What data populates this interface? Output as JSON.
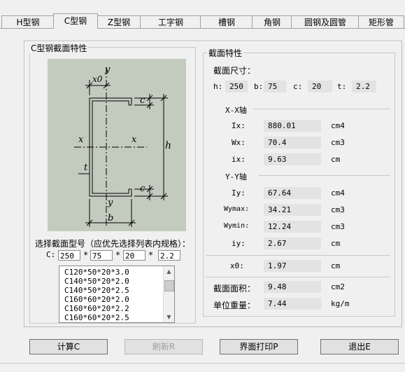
{
  "tabs": [
    "H型钢",
    "C型钢",
    "Z型钢",
    "工字钢",
    "槽钢",
    "角钢",
    "圆钢及圆管",
    "矩形管"
  ],
  "active_tab": 1,
  "left_group": {
    "title": "C型钢截面特性",
    "diagram": {
      "y_top": "y",
      "x0": "x0",
      "c_top": "c",
      "x_left": "x",
      "x_right": "x",
      "h": "h",
      "t": "t",
      "c_bottom": "c",
      "y_bottom": "y",
      "b": "b"
    },
    "select_label": "选择截面型号（应优先选择列表内规格）：",
    "c_label": "C:",
    "inputs": [
      "250",
      "75",
      "20",
      "2.2"
    ],
    "times": "*",
    "list": [
      "C120*50*20*3.0",
      "C140*50*20*2.0",
      "C140*50*20*2.5",
      "C160*60*20*2.0",
      "C160*60*20*2.2",
      "C160*60*20*2.5"
    ]
  },
  "right_group": {
    "title": "截面特性",
    "dims_title": "截面尺寸：",
    "dims": [
      {
        "label": "h:",
        "value": "250"
      },
      {
        "label": "b:",
        "value": "75"
      },
      {
        "label": "c:",
        "value": "20"
      },
      {
        "label": "t:",
        "value": "2.2"
      }
    ],
    "xx_title": "X-X轴",
    "xx": [
      {
        "label": "Ix:",
        "value": "880.01",
        "unit": "cm4"
      },
      {
        "label": "Wx:",
        "value": "70.4",
        "unit": "cm3"
      },
      {
        "label": "ix:",
        "value": "9.63",
        "unit": "cm"
      }
    ],
    "yy_title": "Y-Y轴",
    "yy": [
      {
        "label": "Iy:",
        "value": "67.64",
        "unit": "cm4"
      },
      {
        "label": "Wymax:",
        "value": "34.21",
        "unit": "cm3"
      },
      {
        "label": "Wymin:",
        "value": "12.24",
        "unit": "cm3"
      },
      {
        "label": "iy:",
        "value": "2.67",
        "unit": "cm"
      }
    ],
    "x0": {
      "label": "x0:",
      "value": "1.97",
      "unit": "cm"
    },
    "area": {
      "label": "截面面积：",
      "value": "9.48",
      "unit": "cm2"
    },
    "weight": {
      "label": "单位重量：",
      "value": "7.44",
      "unit": "kg/m"
    }
  },
  "buttons": {
    "calc": "计算C",
    "refresh": "刷新R",
    "print": "界面打印P",
    "exit": "退出E"
  }
}
